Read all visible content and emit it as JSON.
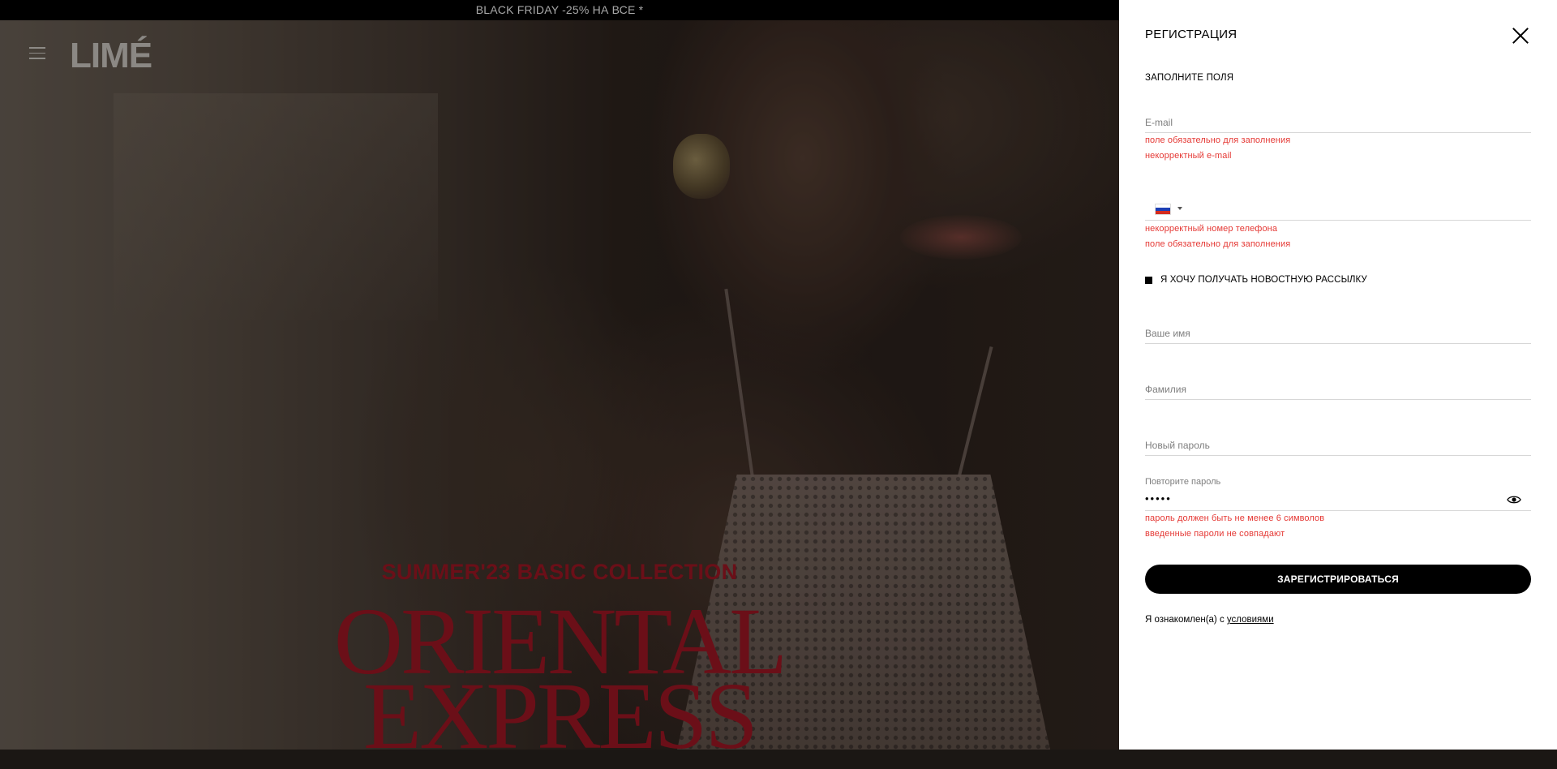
{
  "promo": {
    "text": "BLACK FRIDAY -25% НА ВСЕ *"
  },
  "header": {
    "logo": "LIMÉ"
  },
  "hero": {
    "subtitle": "SUMMER'23 BASIC COLLECTION",
    "title_line1": "ORIENTAL",
    "title_line2": "EXPRESS"
  },
  "panel": {
    "title": "РЕГИСТРАЦИЯ",
    "fill_label": "ЗАПОЛНИТЕ ПОЛЯ",
    "email": {
      "placeholder": "E-mail",
      "value": "",
      "error_required": "поле обязательно для заполнения",
      "error_invalid": "некорректный e-mail"
    },
    "phone": {
      "value": "",
      "country_flag": "ru-flag-icon",
      "error_invalid": "некорректный номер телефона",
      "error_required": "поле обязательно для заполнения"
    },
    "newsletter": {
      "label": "Я ХОЧУ ПОЛУЧАТЬ НОВОСТНУЮ РАССЫЛКУ",
      "checked": true
    },
    "first_name": {
      "placeholder": "Ваше имя",
      "value": ""
    },
    "last_name": {
      "placeholder": "Фамилия",
      "value": ""
    },
    "new_password": {
      "placeholder": "Новый пароль",
      "value": ""
    },
    "repeat_password": {
      "label": "Повторите пароль",
      "value": "•••••",
      "error_length": "пароль должен быть не менее 6 символов",
      "error_mismatch": "введенные пароли не совпадают"
    },
    "submit_label": "ЗАРЕГИСТРИРОВАТЬСЯ",
    "terms_prefix": "Я ознакомлен(а) с",
    "terms_link": "условиями"
  },
  "colors": {
    "error": "#e53935",
    "hero_text": "#6b0f18",
    "button_bg": "#000000"
  }
}
